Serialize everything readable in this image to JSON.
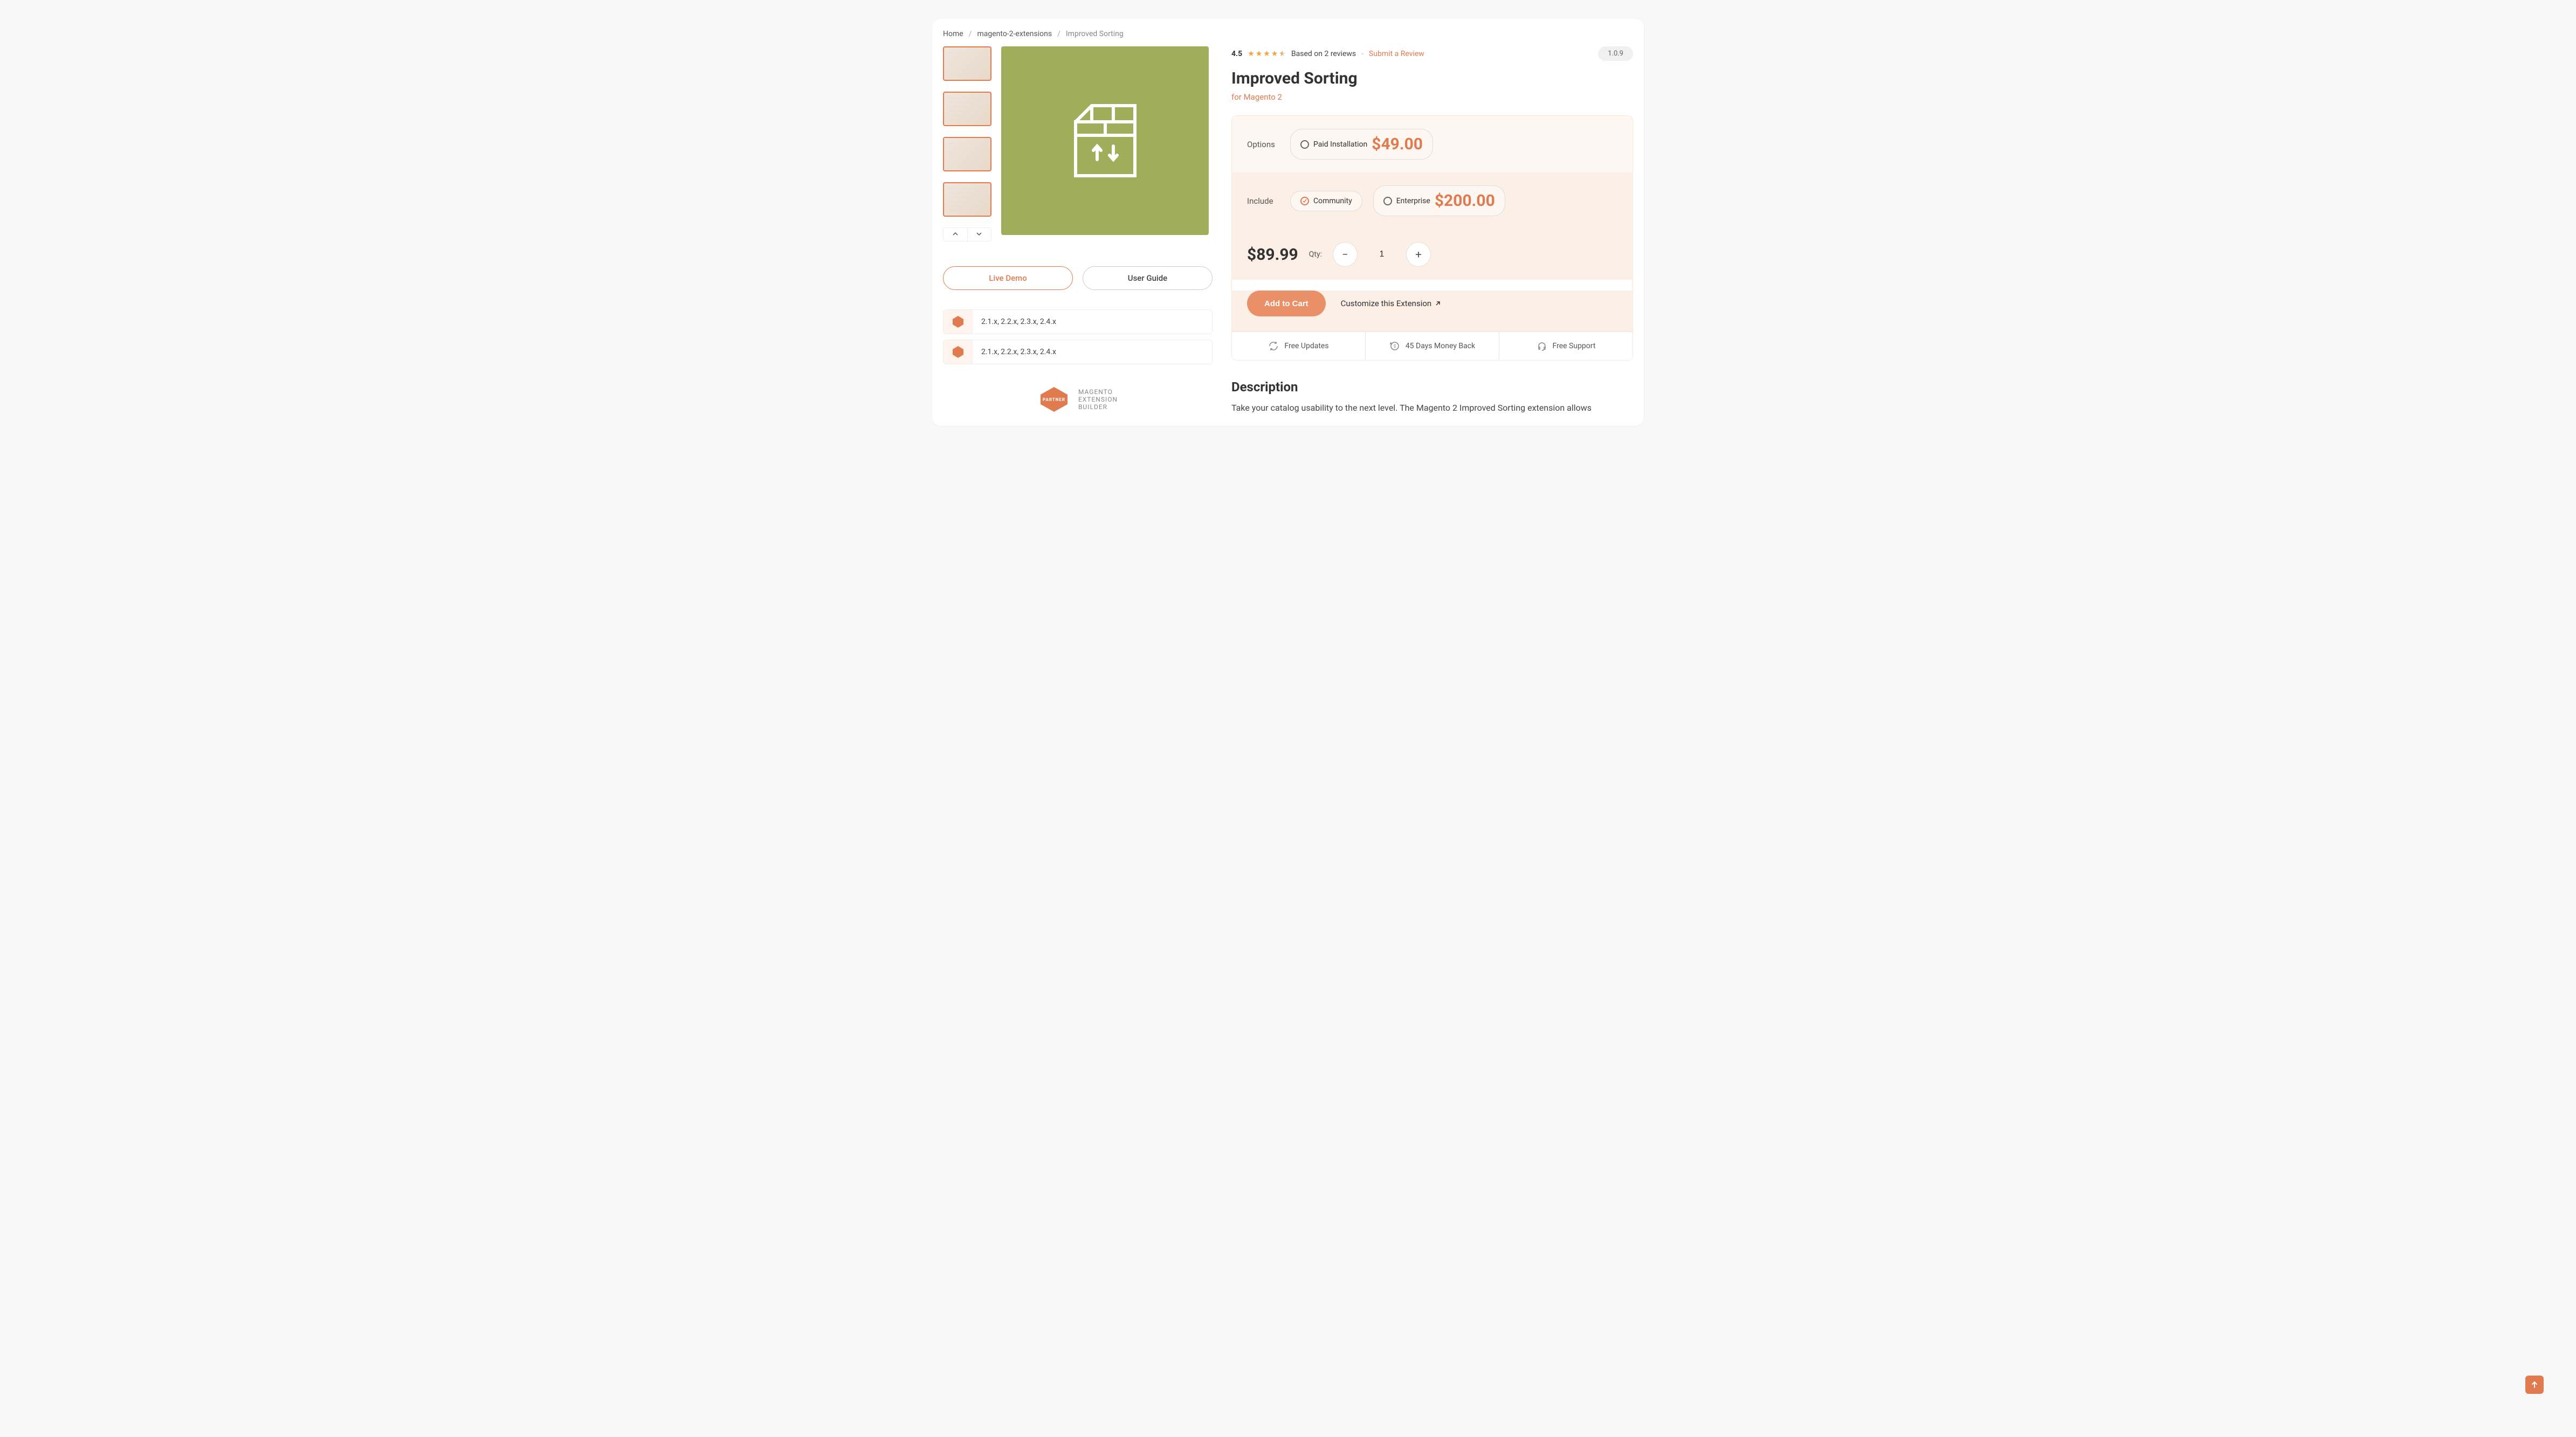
{
  "breadcrumbs": {
    "home": "Home",
    "cat": "magento-2-extensions",
    "current": "Improved Sorting"
  },
  "rating": {
    "score": "4.5",
    "based": "Based on 2 reviews",
    "submit": "Submit a Review"
  },
  "version": "1.0.9",
  "title": "Improved Sorting",
  "subtitle": "for Magento 2",
  "options": {
    "label": "Options",
    "paid_install_label": "Paid Installation",
    "paid_install_price": "$49.00"
  },
  "include": {
    "label": "Include",
    "community": "Community",
    "enterprise_label": "Enterprise",
    "enterprise_price": "$200.00"
  },
  "price": "$89.99",
  "qty_label": "Qty:",
  "qty_value": "1",
  "add_to_cart": "Add to Cart",
  "customize": "Customize this Extension",
  "perks": {
    "updates": "Free Updates",
    "moneyback": "45 Days Money Back",
    "support": "Free Support"
  },
  "buttons": {
    "live_demo": "Live Demo",
    "user_guide": "User Guide"
  },
  "compat": {
    "line1": "2.1.x, 2.2.x, 2.3.x, 2.4.x",
    "line2": "2.1.x, 2.2.x, 2.3.x, 2.4.x"
  },
  "partner": {
    "line1": "MAGENTO",
    "line2": "EXTENSION",
    "line3": "BUILDER"
  },
  "description": {
    "heading": "Description",
    "body": "Take your catalog usability to the next level. The Magento 2 Improved Sorting extension allows"
  }
}
